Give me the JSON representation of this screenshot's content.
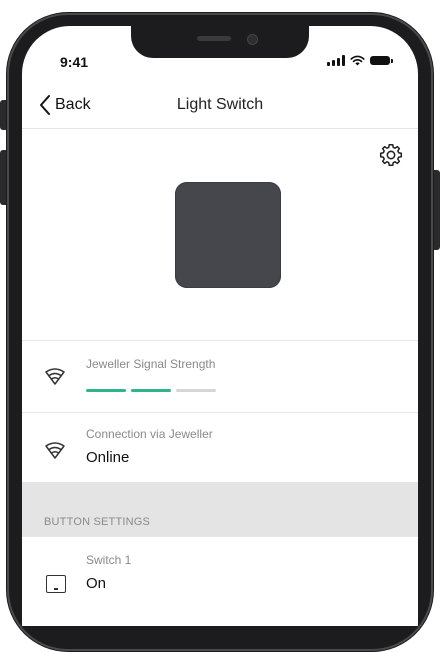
{
  "status_bar": {
    "time": "9:41"
  },
  "nav": {
    "back_label": "Back",
    "title": "Light Switch"
  },
  "device": {
    "icon": "light-switch-device-image",
    "color": "#45474c"
  },
  "signal_strength": {
    "label": "Jeweller Signal Strength",
    "level": 2,
    "max": 3,
    "active_color": "#2fb48d",
    "inactive_color": "#d6d6d6"
  },
  "connection": {
    "label": "Connection via Jeweller",
    "value": "Online"
  },
  "button_settings": {
    "header": "BUTTON SETTINGS",
    "switch_1": {
      "label": "Switch 1",
      "value": "On"
    }
  }
}
